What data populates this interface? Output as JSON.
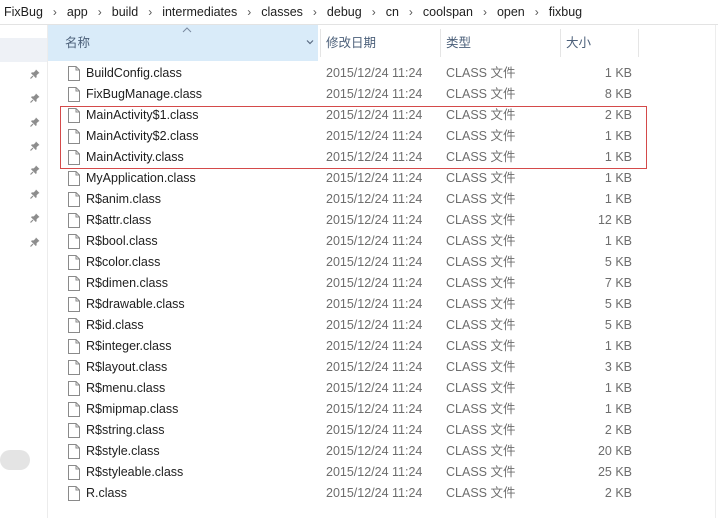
{
  "breadcrumb": [
    "FixBug",
    "app",
    "build",
    "intermediates",
    "classes",
    "debug",
    "cn",
    "coolspan",
    "open",
    "fixbug"
  ],
  "breadcrumb_separator": "›",
  "columns": {
    "name": "名称",
    "date": "修改日期",
    "type": "类型",
    "size": "大小"
  },
  "files": [
    {
      "name": "BuildConfig.class",
      "date": "2015/12/24 11:24",
      "type": "CLASS 文件",
      "size": "1 KB"
    },
    {
      "name": "FixBugManage.class",
      "date": "2015/12/24 11:24",
      "type": "CLASS 文件",
      "size": "8 KB"
    },
    {
      "name": "MainActivity$1.class",
      "date": "2015/12/24 11:24",
      "type": "CLASS 文件",
      "size": "2 KB"
    },
    {
      "name": "MainActivity$2.class",
      "date": "2015/12/24 11:24",
      "type": "CLASS 文件",
      "size": "1 KB"
    },
    {
      "name": "MainActivity.class",
      "date": "2015/12/24 11:24",
      "type": "CLASS 文件",
      "size": "1 KB"
    },
    {
      "name": "MyApplication.class",
      "date": "2015/12/24 11:24",
      "type": "CLASS 文件",
      "size": "1 KB"
    },
    {
      "name": "R$anim.class",
      "date": "2015/12/24 11:24",
      "type": "CLASS 文件",
      "size": "1 KB"
    },
    {
      "name": "R$attr.class",
      "date": "2015/12/24 11:24",
      "type": "CLASS 文件",
      "size": "12 KB"
    },
    {
      "name": "R$bool.class",
      "date": "2015/12/24 11:24",
      "type": "CLASS 文件",
      "size": "1 KB"
    },
    {
      "name": "R$color.class",
      "date": "2015/12/24 11:24",
      "type": "CLASS 文件",
      "size": "5 KB"
    },
    {
      "name": "R$dimen.class",
      "date": "2015/12/24 11:24",
      "type": "CLASS 文件",
      "size": "7 KB"
    },
    {
      "name": "R$drawable.class",
      "date": "2015/12/24 11:24",
      "type": "CLASS 文件",
      "size": "5 KB"
    },
    {
      "name": "R$id.class",
      "date": "2015/12/24 11:24",
      "type": "CLASS 文件",
      "size": "5 KB"
    },
    {
      "name": "R$integer.class",
      "date": "2015/12/24 11:24",
      "type": "CLASS 文件",
      "size": "1 KB"
    },
    {
      "name": "R$layout.class",
      "date": "2015/12/24 11:24",
      "type": "CLASS 文件",
      "size": "3 KB"
    },
    {
      "name": "R$menu.class",
      "date": "2015/12/24 11:24",
      "type": "CLASS 文件",
      "size": "1 KB"
    },
    {
      "name": "R$mipmap.class",
      "date": "2015/12/24 11:24",
      "type": "CLASS 文件",
      "size": "1 KB"
    },
    {
      "name": "R$string.class",
      "date": "2015/12/24 11:24",
      "type": "CLASS 文件",
      "size": "2 KB"
    },
    {
      "name": "R$style.class",
      "date": "2015/12/24 11:24",
      "type": "CLASS 文件",
      "size": "20 KB"
    },
    {
      "name": "R$styleable.class",
      "date": "2015/12/24 11:24",
      "type": "CLASS 文件",
      "size": "25 KB"
    },
    {
      "name": "R.class",
      "date": "2015/12/24 11:24",
      "type": "CLASS 文件",
      "size": "2 KB"
    }
  ],
  "highlighted_files": [
    "MainActivity$1.class",
    "MainActivity$2.class",
    "MainActivity.class"
  ],
  "sort": {
    "column": "name",
    "direction": "ascending"
  },
  "icons": {
    "file": "file-icon",
    "pin": "pin-icon",
    "sort": "sort-ascending-icon",
    "dropdown": "chevron-down-icon"
  },
  "colors": {
    "sorted_header_bg": "#d9ebf9",
    "header_text": "#4c607a",
    "highlight_box": "#d44a4a"
  }
}
